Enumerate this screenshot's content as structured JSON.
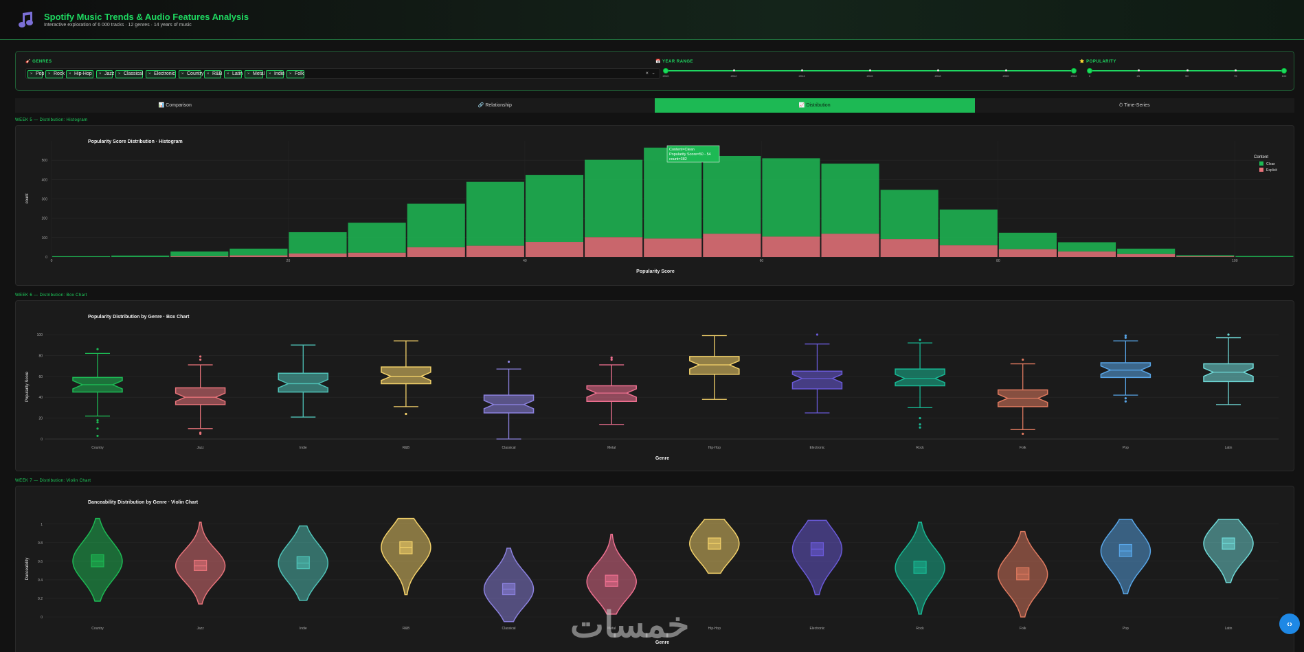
{
  "header": {
    "title": "Spotify Music Trends & Audio Features Analysis",
    "subtitle": "Interactive exploration of 6 000 tracks · 12 genres · 14 years of music"
  },
  "filters": {
    "genres_label": "GENRES",
    "genre_chips": [
      "Pop",
      "Rock",
      "Hip-Hop",
      "Jazz",
      "Classical",
      "Electronic",
      "Country",
      "R&B",
      "Latin",
      "Metal",
      "Indie",
      "Folk"
    ],
    "chip_remove_glyph": "×",
    "clear_glyph": "×",
    "caret_glyph": "⌄",
    "year_label": "YEAR RANGE",
    "year_ticks": [
      "2010",
      "2012",
      "2014",
      "2016",
      "2018",
      "2020",
      "2022"
    ],
    "year_range": [
      2010,
      2023
    ],
    "popularity_label": "POPULARITY",
    "popularity_ticks": [
      "0",
      "25",
      "50",
      "75",
      "100"
    ],
    "popularity_range": [
      0,
      100
    ]
  },
  "tabs": [
    {
      "icon": "📊",
      "label": "Comparison"
    },
    {
      "icon": "🔗",
      "label": "Relationship"
    },
    {
      "icon": "📈",
      "label": "Distribution",
      "active": true
    },
    {
      "icon": "⏱",
      "label": "Time-Series"
    }
  ],
  "sections": {
    "hist_week": "WEEK 5 — Distribution: Histogram",
    "box_week": "WEEK 6 — Distribution: Box Chart",
    "violin_week": "WEEK 7 — Distribution: Violin Chart"
  },
  "colors": {
    "accent": "#1ed760",
    "clean": "#1db954",
    "explicit": "#e8737a"
  },
  "chart_data": [
    {
      "type": "bar",
      "title": "Popularity Score Distribution · Histogram",
      "xlabel": "Popularity Score",
      "ylabel": "count",
      "xlim": [
        0,
        103
      ],
      "ylim": [
        0,
        600
      ],
      "xticks": [
        "0",
        "20",
        "40",
        "60",
        "80",
        "100"
      ],
      "yticks": [
        "0",
        "100",
        "200",
        "300",
        "400",
        "500"
      ],
      "bin_width": 5,
      "bin_starts": [
        0,
        5,
        10,
        15,
        20,
        25,
        30,
        35,
        40,
        45,
        50,
        55,
        60,
        65,
        70,
        75,
        80,
        85,
        90,
        95,
        100
      ],
      "legend_title": "Content",
      "legend_position": "top-right",
      "series": [
        {
          "name": "Explicit",
          "color": "#e8737a",
          "values": [
            0,
            0,
            3,
            8,
            18,
            22,
            50,
            58,
            78,
            102,
            95,
            120,
            105,
            120,
            92,
            60,
            40,
            28,
            15,
            3,
            0
          ]
        },
        {
          "name": "Clean",
          "color": "#1db954",
          "values": [
            4,
            7,
            25,
            35,
            110,
            155,
            225,
            330,
            345,
            400,
            470,
            402,
            405,
            362,
            255,
            185,
            85,
            48,
            28,
            6,
            5
          ]
        }
      ],
      "tooltip": {
        "lines": [
          "Content=Clean",
          "Popularity Score=50 - 54",
          "count=382"
        ]
      }
    },
    {
      "type": "box",
      "title": "Popularity Distribution by Genre · Box Chart",
      "xlabel": "Genre",
      "ylabel": "Popularity Score",
      "ylim": [
        0,
        100
      ],
      "yticks": [
        "0",
        "20",
        "40",
        "60",
        "80",
        "100"
      ],
      "categories": [
        "Country",
        "Jazz",
        "Indie",
        "R&B",
        "Classical",
        "Metal",
        "Hip-Hop",
        "Electronic",
        "Rock",
        "Folk",
        "Pop",
        "Latin"
      ],
      "colors": [
        "#1db954",
        "#e8737a",
        "#4fc3b8",
        "#f4d26a",
        "#8c82e0",
        "#ee7090",
        "#f4d26a",
        "#6a5ad8",
        "#18b894",
        "#e07a5f",
        "#58a6e8",
        "#6fdad8"
      ],
      "boxes": [
        {
          "min": 22,
          "q1": 45,
          "median": 52,
          "q3": 59,
          "max": 82,
          "outliers": [
            3,
            10,
            16,
            18,
            86
          ]
        },
        {
          "min": 10,
          "q1": 33,
          "median": 40,
          "q3": 49,
          "max": 71,
          "outliers": [
            5,
            6,
            76,
            79
          ]
        },
        {
          "min": 21,
          "q1": 45,
          "median": 53,
          "q3": 63,
          "max": 90,
          "outliers": []
        },
        {
          "min": 31,
          "q1": 53,
          "median": 60,
          "q3": 69,
          "max": 94,
          "outliers": [
            24
          ]
        },
        {
          "min": 0,
          "q1": 25,
          "median": 33,
          "q3": 42,
          "max": 67,
          "outliers": [
            74
          ]
        },
        {
          "min": 14,
          "q1": 36,
          "median": 44,
          "q3": 51,
          "max": 71,
          "outliers": [
            76,
            78
          ]
        },
        {
          "min": 38,
          "q1": 62,
          "median": 71,
          "q3": 79,
          "max": 99,
          "outliers": []
        },
        {
          "min": 25,
          "q1": 48,
          "median": 58,
          "q3": 65,
          "max": 91,
          "outliers": [
            100
          ]
        },
        {
          "min": 30,
          "q1": 51,
          "median": 58,
          "q3": 67,
          "max": 92,
          "outliers": [
            11,
            14,
            20,
            95
          ]
        },
        {
          "min": 9,
          "q1": 31,
          "median": 39,
          "q3": 47,
          "max": 72,
          "outliers": [
            5,
            76
          ]
        },
        {
          "min": 42,
          "q1": 59,
          "median": 66,
          "q3": 73,
          "max": 94,
          "outliers": [
            36,
            39,
            97,
            99
          ]
        },
        {
          "min": 33,
          "q1": 55,
          "median": 64,
          "q3": 72,
          "max": 97,
          "outliers": [
            100
          ]
        }
      ]
    },
    {
      "type": "violin",
      "title": "Danceability Distribution by Genre · Violin Chart",
      "xlabel": "Genre",
      "ylabel": "Danceability",
      "ylim": [
        0,
        1.05
      ],
      "yticks": [
        "0",
        "0.2",
        "0.4",
        "0.6",
        "0.8",
        "1"
      ],
      "categories": [
        "Country",
        "Jazz",
        "Indie",
        "R&B",
        "Classical",
        "Metal",
        "Hip-Hop",
        "Electronic",
        "Rock",
        "Folk",
        "Pop",
        "Latin"
      ],
      "colors": [
        "#1db954",
        "#e8737a",
        "#4fc3b8",
        "#f4d26a",
        "#8c82e0",
        "#ee7090",
        "#f4d26a",
        "#6a5ad8",
        "#18b894",
        "#e07a5f",
        "#58a6e8",
        "#6fdad8"
      ],
      "violins": [
        {
          "min": 0.17,
          "max": 1.06,
          "median": 0.6,
          "q1": 0.54,
          "q3": 0.67
        },
        {
          "min": 0.14,
          "max": 1.02,
          "median": 0.55,
          "q1": 0.5,
          "q3": 0.61
        },
        {
          "min": 0.18,
          "max": 0.98,
          "median": 0.58,
          "q1": 0.52,
          "q3": 0.65
        },
        {
          "min": 0.24,
          "max": 1.06,
          "median": 0.75,
          "q1": 0.68,
          "q3": 0.81
        },
        {
          "min": -0.05,
          "max": 0.74,
          "median": 0.3,
          "q1": 0.24,
          "q3": 0.36
        },
        {
          "min": 0.03,
          "max": 0.89,
          "median": 0.38,
          "q1": 0.33,
          "q3": 0.45
        },
        {
          "min": 0.47,
          "max": 1.05,
          "median": 0.79,
          "q1": 0.73,
          "q3": 0.85
        },
        {
          "min": 0.24,
          "max": 1.04,
          "median": 0.73,
          "q1": 0.66,
          "q3": 0.8
        },
        {
          "min": 0.03,
          "max": 1.02,
          "median": 0.53,
          "q1": 0.47,
          "q3": 0.6
        },
        {
          "min": 0.0,
          "max": 0.92,
          "median": 0.46,
          "q1": 0.4,
          "q3": 0.53
        },
        {
          "min": 0.25,
          "max": 1.05,
          "median": 0.71,
          "q1": 0.65,
          "q3": 0.78
        },
        {
          "min": 0.37,
          "max": 1.05,
          "median": 0.79,
          "q1": 0.73,
          "q3": 0.85
        }
      ]
    }
  ],
  "fab": {
    "glyph": "‹›"
  },
  "watermark": {
    "text": "خمسات"
  }
}
